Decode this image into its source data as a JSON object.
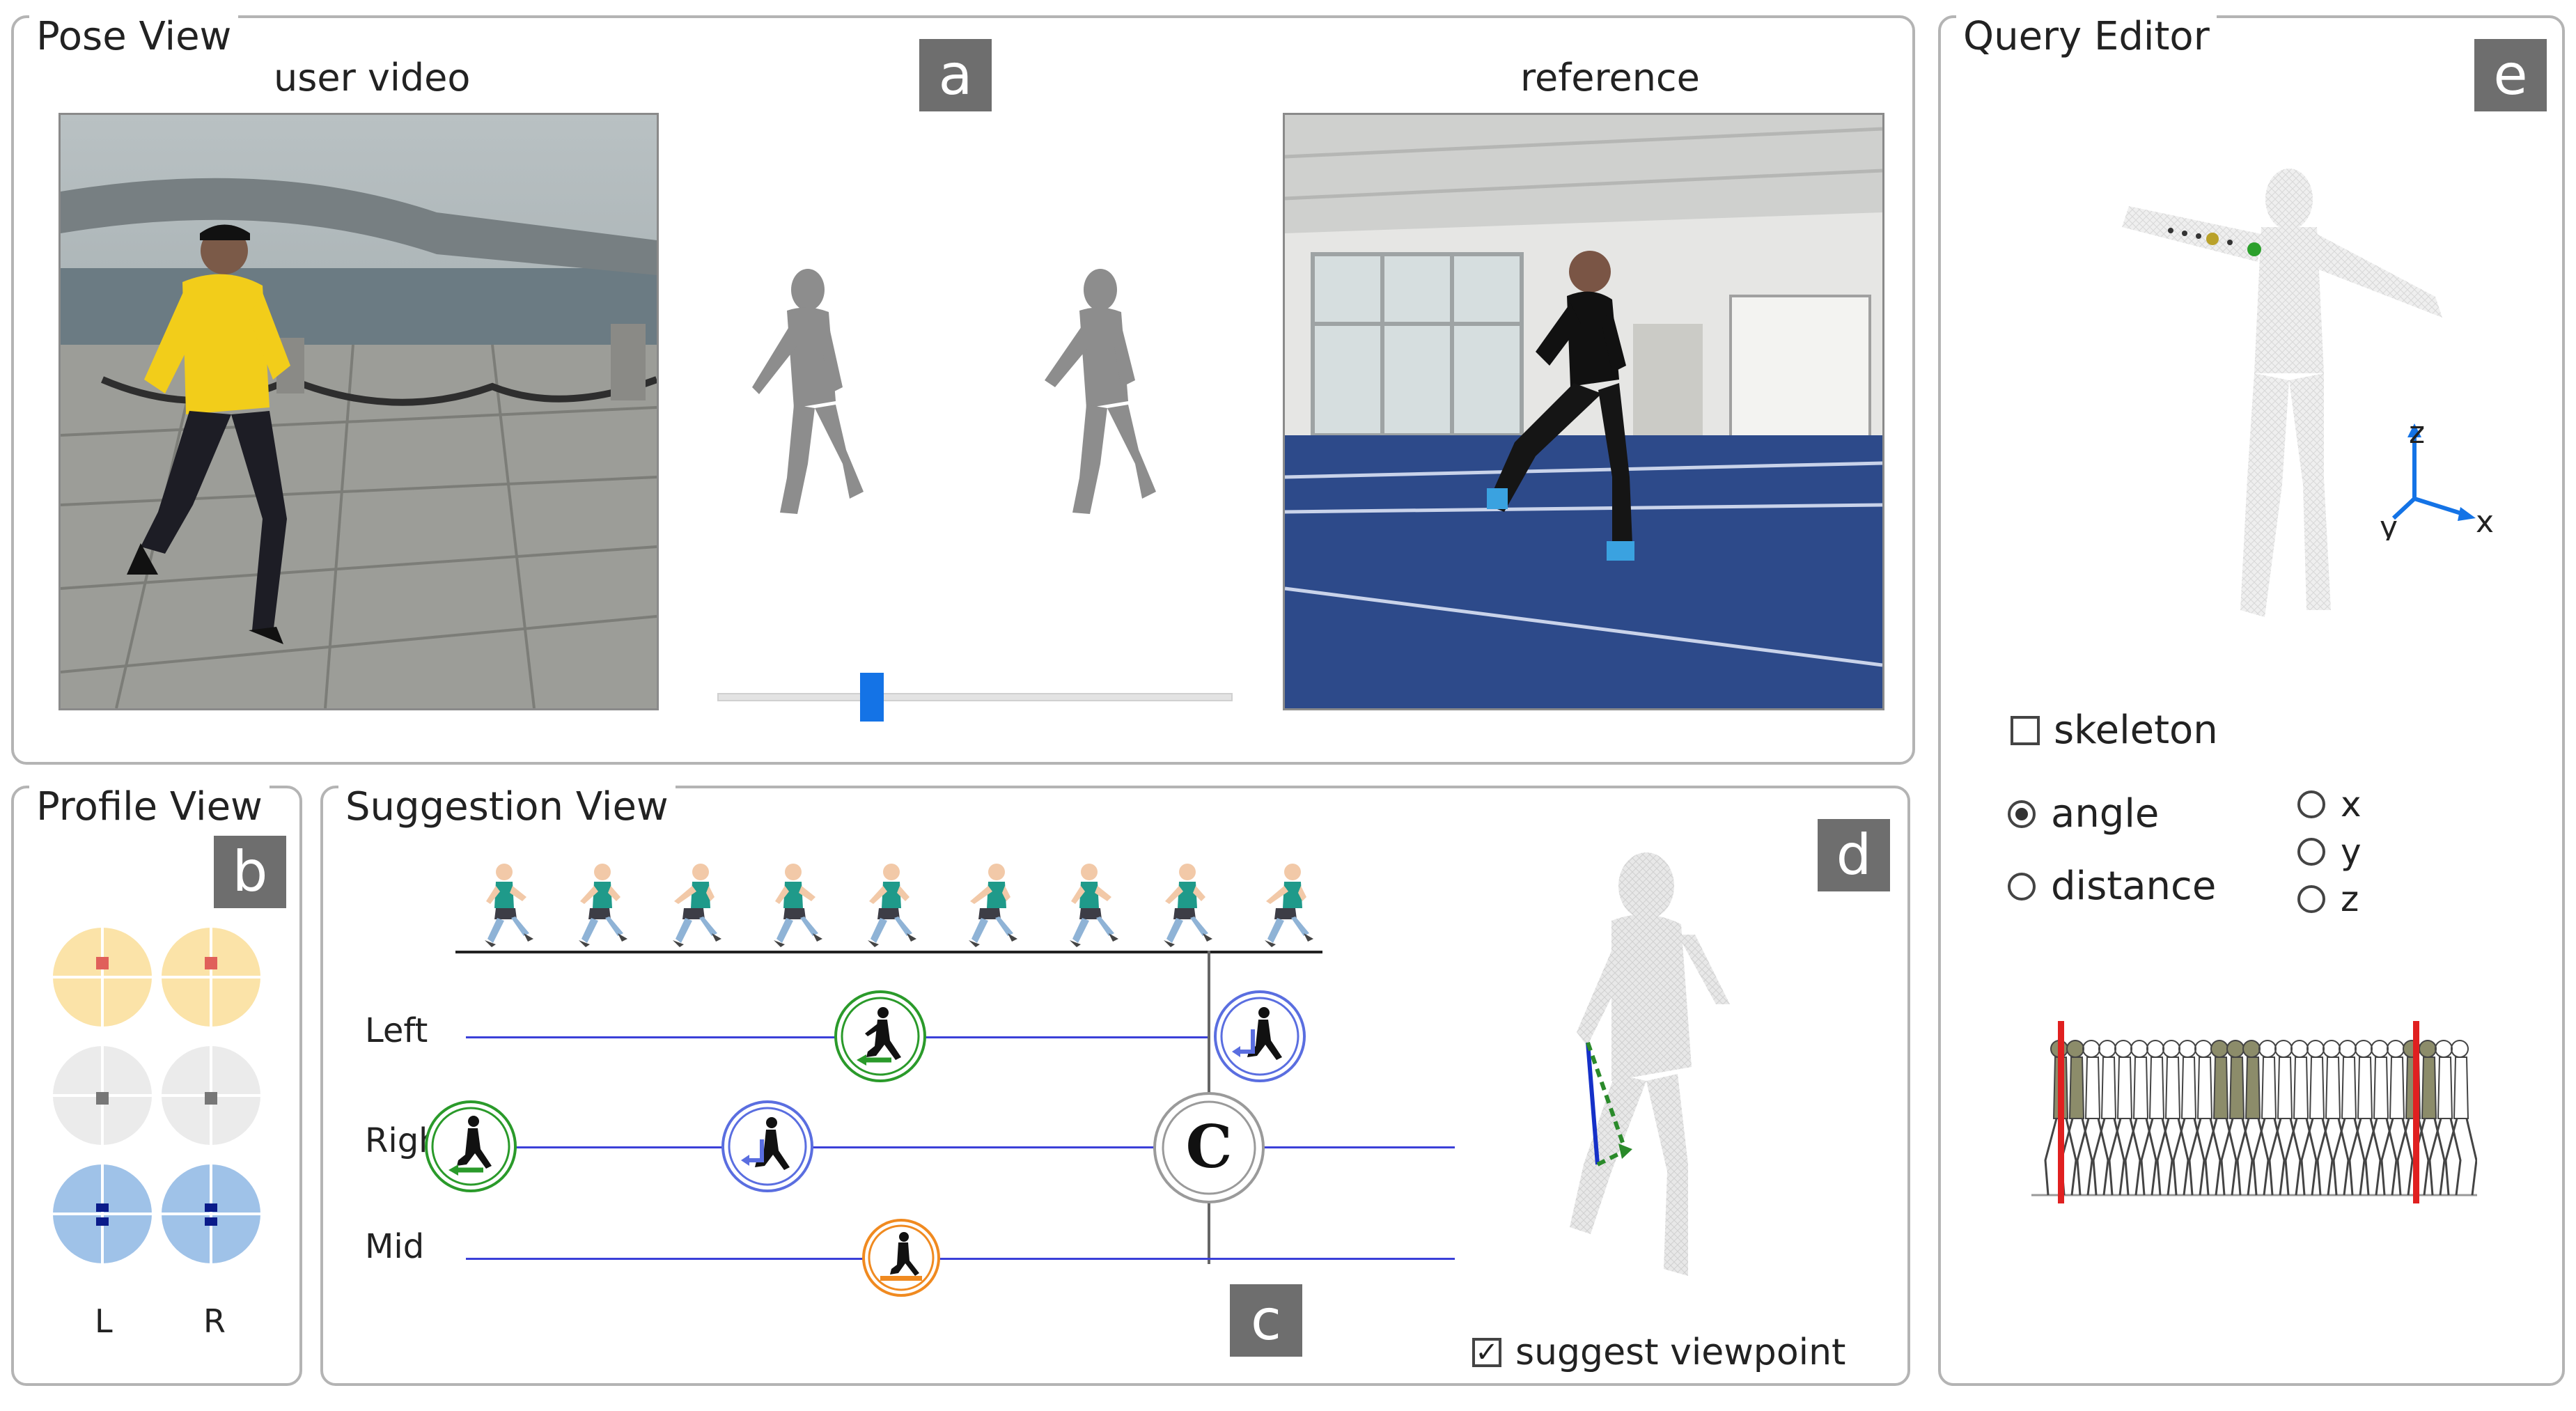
{
  "pose_view": {
    "title": "Pose View",
    "tag": "a",
    "user_video_label": "user video",
    "reference_label": "reference",
    "playback_slider": {
      "position": 0.29
    }
  },
  "profile_view": {
    "title": "Profile View",
    "tag": "b",
    "left_label": "L",
    "right_label": "R",
    "rows": [
      {
        "color": "#fbe3a8",
        "dot": "#e0605a"
      },
      {
        "color": "#ebebeb",
        "dot": "#777777"
      },
      {
        "color": "#9fc2e8",
        "dot": "#0a1b8a"
      }
    ]
  },
  "suggestion_view": {
    "title": "Suggestion View",
    "tag": "c",
    "rows": [
      {
        "label": "Left"
      },
      {
        "label": "Righ"
      },
      {
        "label": "Mid"
      }
    ],
    "current_marker": "C",
    "frames": 9
  },
  "detail_view": {
    "tag": "d",
    "suggest_viewpoint": {
      "label": "suggest viewpoint",
      "checked": true
    }
  },
  "query_editor": {
    "title": "Query Editor",
    "tag": "e",
    "axes": {
      "x": "x",
      "y": "y",
      "z": "z"
    },
    "skeleton": {
      "label": "skeleton",
      "checked": false
    },
    "measure_options": [
      {
        "label": "angle",
        "selected": true
      },
      {
        "label": "distance",
        "selected": false
      }
    ],
    "axis_options": [
      {
        "label": "x",
        "selected": false
      },
      {
        "label": "y",
        "selected": false
      },
      {
        "label": "z",
        "selected": false
      }
    ]
  },
  "colors": {
    "rail": "#3b40d8",
    "marker_green": "#2a9a2a",
    "marker_blue": "#5a6ee0",
    "marker_orange": "#f08a20",
    "slider": "#1473e6",
    "tag_bg": "#6e6e6e",
    "range_red": "#e02020"
  }
}
